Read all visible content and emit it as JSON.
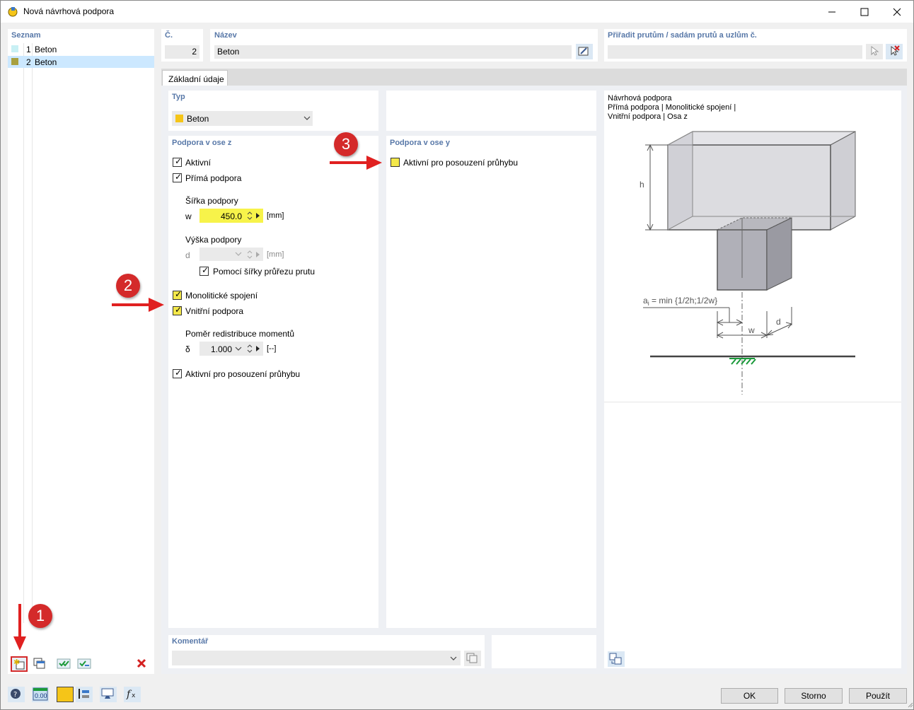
{
  "window": {
    "title": "Nová návrhová podpora"
  },
  "list": {
    "header": "Seznam",
    "items": [
      {
        "num": "1",
        "label": "Beton",
        "color": "#c8f0f4"
      },
      {
        "num": "2",
        "label": "Beton",
        "color": "#a8a040"
      }
    ]
  },
  "number": {
    "header": "Č.",
    "value": "2"
  },
  "name": {
    "header": "Název",
    "value": "Beton"
  },
  "assign": {
    "header": "Přiřadit prutům / sadám prutů a uzlům č.",
    "value": ""
  },
  "tabs": [
    {
      "label": "Základní údaje"
    }
  ],
  "type_section": {
    "header": "Typ",
    "selected": "Beton",
    "color": "#f5c518"
  },
  "support_z": {
    "header": "Podpora v ose z",
    "active": "Aktivní",
    "direct": "Přímá podpora",
    "width_title": "Šířka podpory",
    "width_symbol": "w",
    "width_value": "450.0",
    "width_unit": "[mm]",
    "height_title": "Výška podpory",
    "height_symbol": "d",
    "height_value": "",
    "height_unit": "[mm]",
    "by_section": "Pomocí šířky průřezu prutu",
    "monolithic": "Monolitické spojení",
    "internal": "Vnitřní podpora",
    "ratio_title": "Poměr redistribuce momentů",
    "ratio_symbol": "δ",
    "ratio_value": "1.000",
    "ratio_unit": "[--]",
    "deflection": "Aktivní pro posouzení průhybu"
  },
  "support_y": {
    "header": "Podpora v ose y",
    "deflection": "Aktivní pro posouzení průhybu"
  },
  "preview": {
    "line1": "Návrhová podpora",
    "line2": "Přímá podpora | Monolitické spojení |",
    "line3": "Vnitřní podpora | Osa z",
    "h_label": "h",
    "formula_a": "a",
    "formula_sub": "i",
    "formula_rest": " = min {1/2h;1/2w}",
    "w_label": "w",
    "d_label": "d"
  },
  "comment": {
    "header": "Komentář",
    "value": ""
  },
  "buttons": {
    "ok": "OK",
    "cancel": "Storno",
    "apply": "Použít"
  },
  "status": {
    "units_value": "0.00"
  },
  "annotations": {
    "b1": "1",
    "b2": "2",
    "b3": "3"
  },
  "colors": {
    "accent_header": "#5878a8",
    "highlight_input": "#f7f34a",
    "annotation_red": "#d42a2a",
    "selection": "#cce8ff"
  }
}
